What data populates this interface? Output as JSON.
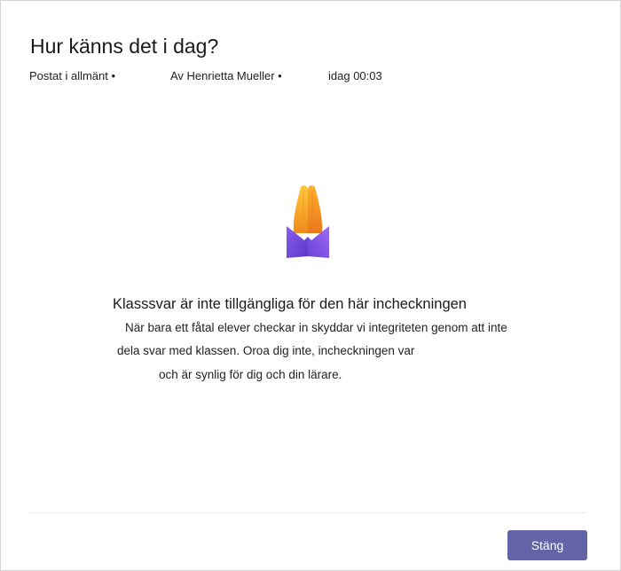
{
  "dialog": {
    "title": "Hur känns det i dag?",
    "meta": {
      "posted": "Postat i allmänt •",
      "author": "Av Henrietta Mueller •",
      "time": "idag 00:03"
    },
    "illustration_icon": "praying-hands-icon",
    "message": {
      "title": "Klasssvar är inte tillgängliga för den här incheckningen",
      "line1": "När bara ett fåtal elever checkar in skyddar vi integriteten genom att inte",
      "line2": "dela svar med klassen. Oroa dig inte, incheckningen var",
      "line3": "och är synlig för dig och din lärare."
    },
    "close_label": "Stäng",
    "colors": {
      "accent": "#6264a7",
      "hands": "#f5a623",
      "cuff": "#7b4fd8"
    }
  }
}
